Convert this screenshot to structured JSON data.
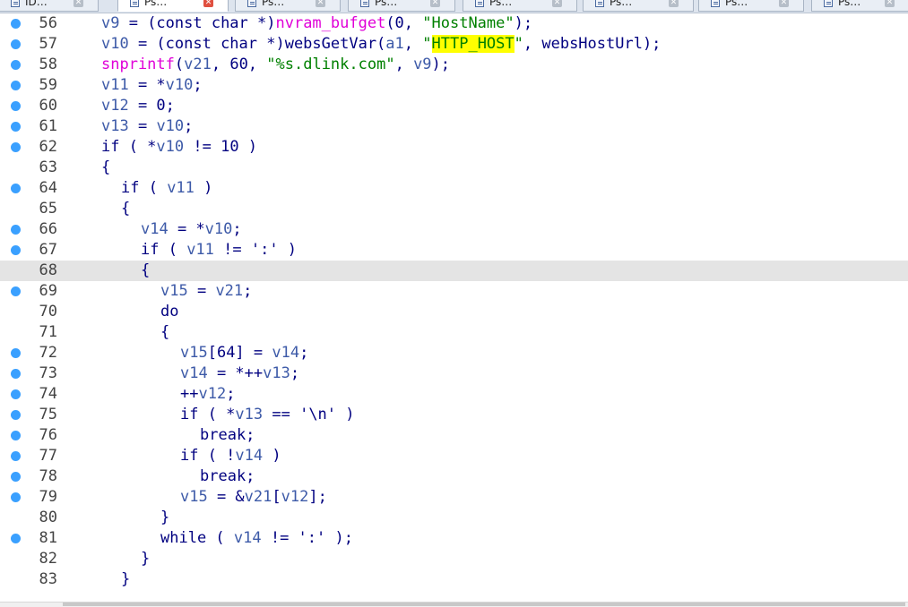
{
  "tabs": [
    {
      "label": "ID…",
      "active": false
    },
    {
      "label": "Ps…",
      "active": true
    },
    {
      "label": "Ps…",
      "active": false
    },
    {
      "label": "Ps…",
      "active": false
    },
    {
      "label": "Ps…",
      "active": false
    },
    {
      "label": "Ps…",
      "active": false
    },
    {
      "label": "Ps…",
      "active": false
    },
    {
      "label": "Ps…",
      "active": false
    }
  ],
  "tab_close_glyph": "✕",
  "colors": {
    "keyword": "#000080",
    "variable": "#3d5aa8",
    "string": "#008000",
    "function": "#e000d8",
    "search_highlight": "#ffff00",
    "breakpoint_dot": "#3aa0ff",
    "current_line": "#e4e4e4"
  },
  "code": {
    "current_line": 68,
    "lines": [
      {
        "num": "56",
        "bp": true,
        "indent": 0,
        "tokens": [
          [
            "v",
            "v9"
          ],
          [
            "k",
            " = (const char *)"
          ],
          [
            "f",
            "nvram_bufget"
          ],
          [
            "k",
            "(0, "
          ],
          [
            "s",
            "\"HostName\""
          ],
          [
            "k",
            ");"
          ]
        ]
      },
      {
        "num": "57",
        "bp": true,
        "indent": 0,
        "tokens": [
          [
            "v",
            "v10"
          ],
          [
            "k",
            " = (const char *)websGetVar("
          ],
          [
            "v",
            "a1"
          ],
          [
            "k",
            ", "
          ],
          [
            "s",
            "\""
          ],
          [
            "hl",
            "HTTP_HOST"
          ],
          [
            "s",
            "\""
          ],
          [
            "k",
            ", websHostUrl);"
          ]
        ]
      },
      {
        "num": "58",
        "bp": true,
        "indent": 0,
        "tokens": [
          [
            "f",
            "snprintf"
          ],
          [
            "k",
            "("
          ],
          [
            "v",
            "v21"
          ],
          [
            "k",
            ", 60, "
          ],
          [
            "s",
            "\"%s.dlink.com\""
          ],
          [
            "k",
            ", "
          ],
          [
            "v",
            "v9"
          ],
          [
            "k",
            ");"
          ]
        ]
      },
      {
        "num": "59",
        "bp": true,
        "indent": 0,
        "tokens": [
          [
            "v",
            "v11"
          ],
          [
            "k",
            " = *"
          ],
          [
            "v",
            "v10"
          ],
          [
            "k",
            ";"
          ]
        ]
      },
      {
        "num": "60",
        "bp": true,
        "indent": 0,
        "tokens": [
          [
            "v",
            "v12"
          ],
          [
            "k",
            " = 0;"
          ]
        ]
      },
      {
        "num": "61",
        "bp": true,
        "indent": 0,
        "tokens": [
          [
            "v",
            "v13"
          ],
          [
            "k",
            " = "
          ],
          [
            "v",
            "v10"
          ],
          [
            "k",
            ";"
          ]
        ]
      },
      {
        "num": "62",
        "bp": true,
        "indent": 0,
        "tokens": [
          [
            "k",
            "if ( *"
          ],
          [
            "v",
            "v10"
          ],
          [
            "k",
            " != 10 )"
          ]
        ]
      },
      {
        "num": "63",
        "bp": false,
        "indent": 0,
        "tokens": [
          [
            "k",
            "{"
          ]
        ]
      },
      {
        "num": "64",
        "bp": true,
        "indent": 1,
        "tokens": [
          [
            "k",
            "if ( "
          ],
          [
            "v",
            "v11"
          ],
          [
            "k",
            " )"
          ]
        ]
      },
      {
        "num": "65",
        "bp": false,
        "indent": 1,
        "tokens": [
          [
            "k",
            "{"
          ]
        ]
      },
      {
        "num": "66",
        "bp": true,
        "indent": 2,
        "tokens": [
          [
            "v",
            "v14"
          ],
          [
            "k",
            " = *"
          ],
          [
            "v",
            "v10"
          ],
          [
            "k",
            ";"
          ]
        ]
      },
      {
        "num": "67",
        "bp": true,
        "indent": 2,
        "tokens": [
          [
            "k",
            "if ( "
          ],
          [
            "v",
            "v11"
          ],
          [
            "k",
            " != ':' )"
          ]
        ]
      },
      {
        "num": "68",
        "bp": false,
        "indent": 2,
        "tokens": [
          [
            "k",
            "{"
          ]
        ]
      },
      {
        "num": "69",
        "bp": true,
        "indent": 3,
        "tokens": [
          [
            "v",
            "v15"
          ],
          [
            "k",
            " = "
          ],
          [
            "v",
            "v21"
          ],
          [
            "k",
            ";"
          ]
        ]
      },
      {
        "num": "70",
        "bp": false,
        "indent": 3,
        "tokens": [
          [
            "k",
            "do"
          ]
        ]
      },
      {
        "num": "71",
        "bp": false,
        "indent": 3,
        "tokens": [
          [
            "k",
            "{"
          ]
        ]
      },
      {
        "num": "72",
        "bp": true,
        "indent": 4,
        "tokens": [
          [
            "v",
            "v15"
          ],
          [
            "k",
            "[64] = "
          ],
          [
            "v",
            "v14"
          ],
          [
            "k",
            ";"
          ]
        ]
      },
      {
        "num": "73",
        "bp": true,
        "indent": 4,
        "tokens": [
          [
            "v",
            "v14"
          ],
          [
            "k",
            " = *++"
          ],
          [
            "v",
            "v13"
          ],
          [
            "k",
            ";"
          ]
        ]
      },
      {
        "num": "74",
        "bp": true,
        "indent": 4,
        "tokens": [
          [
            "k",
            "++"
          ],
          [
            "v",
            "v12"
          ],
          [
            "k",
            ";"
          ]
        ]
      },
      {
        "num": "75",
        "bp": true,
        "indent": 4,
        "tokens": [
          [
            "k",
            "if ( *"
          ],
          [
            "v",
            "v13"
          ],
          [
            "k",
            " == '\\n' )"
          ]
        ]
      },
      {
        "num": "76",
        "bp": true,
        "indent": 5,
        "tokens": [
          [
            "k",
            "break;"
          ]
        ]
      },
      {
        "num": "77",
        "bp": true,
        "indent": 4,
        "tokens": [
          [
            "k",
            "if ( !"
          ],
          [
            "v",
            "v14"
          ],
          [
            "k",
            " )"
          ]
        ]
      },
      {
        "num": "78",
        "bp": true,
        "indent": 5,
        "tokens": [
          [
            "k",
            "break;"
          ]
        ]
      },
      {
        "num": "79",
        "bp": true,
        "indent": 4,
        "tokens": [
          [
            "v",
            "v15"
          ],
          [
            "k",
            " = &"
          ],
          [
            "v",
            "v21"
          ],
          [
            "k",
            "["
          ],
          [
            "v",
            "v12"
          ],
          [
            "k",
            "];"
          ]
        ]
      },
      {
        "num": "80",
        "bp": false,
        "indent": 3,
        "tokens": [
          [
            "k",
            "}"
          ]
        ]
      },
      {
        "num": "81",
        "bp": true,
        "indent": 3,
        "tokens": [
          [
            "k",
            "while ( "
          ],
          [
            "v",
            "v14"
          ],
          [
            "k",
            " != ':' );"
          ]
        ]
      },
      {
        "num": "82",
        "bp": false,
        "indent": 2,
        "tokens": [
          [
            "k",
            "}"
          ]
        ]
      },
      {
        "num": "83",
        "bp": false,
        "indent": 1,
        "tokens": [
          [
            "k",
            "}"
          ]
        ]
      }
    ]
  }
}
